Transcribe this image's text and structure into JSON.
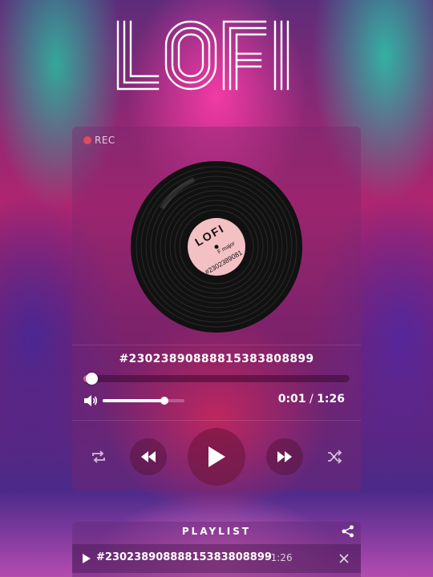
{
  "app": {
    "logo_text": "LOFI"
  },
  "player": {
    "rec_label": "REC",
    "record_label": {
      "brand": "LOFI",
      "key": "F major",
      "id": "#2302389081"
    },
    "track_title": "#23023890888815383808899",
    "progress_fraction": 0.01,
    "volume_fraction": 0.75,
    "time": {
      "current": "0:01",
      "separator": " / ",
      "total": "1:26"
    },
    "controls": {
      "repeat_icon": "repeat-icon",
      "previous_icon": "previous-track-icon",
      "play_icon": "play-icon",
      "next_icon": "next-track-icon",
      "shuffle_icon": "shuffle-icon",
      "volume_icon": "speaker-icon"
    },
    "accent_color": "#e36b8a"
  },
  "playlist": {
    "title": "PLAYLIST",
    "share_icon": "share-icon",
    "items": [
      {
        "name": "#23023890888815383808899",
        "duration": "· 1:26"
      }
    ]
  }
}
